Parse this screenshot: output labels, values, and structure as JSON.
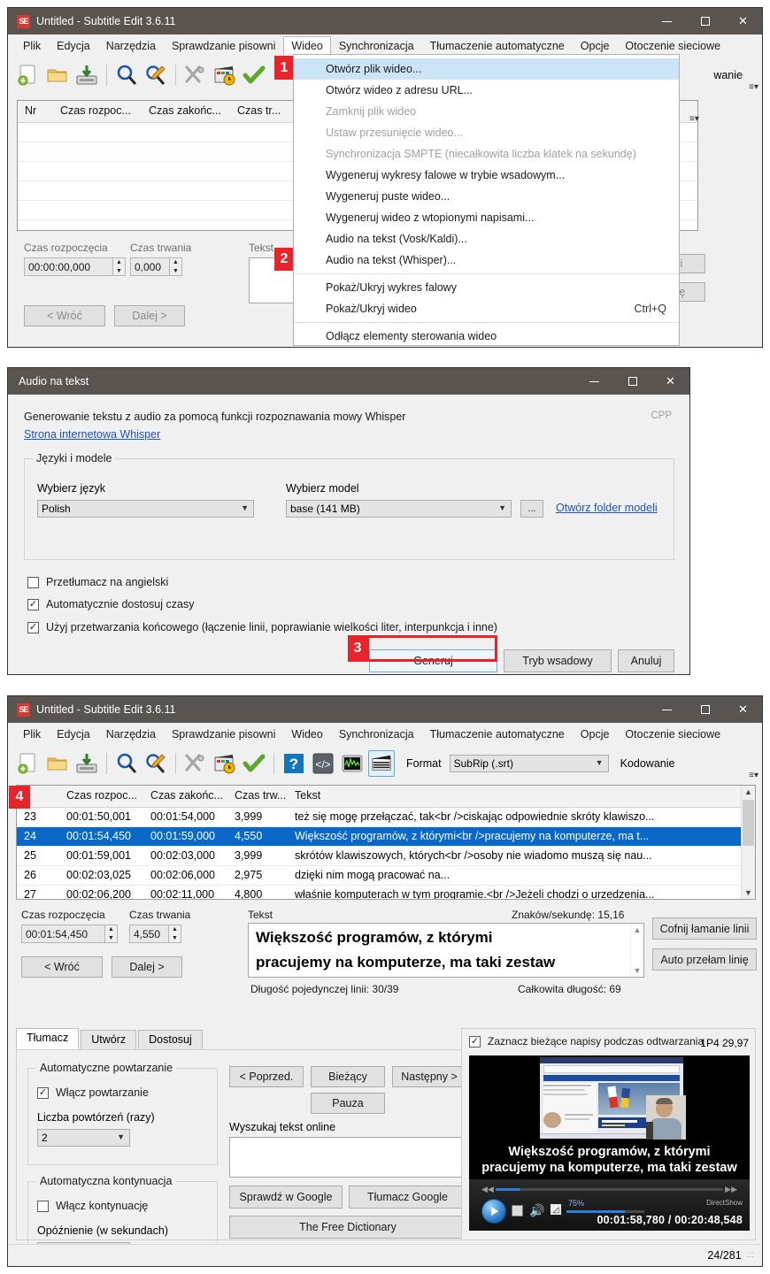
{
  "panel1": {
    "title": "Untitled - Subtitle Edit 3.6.11",
    "app_icon": "SE",
    "window_controls": {
      "minimize": "minimize-icon",
      "maximize": "maximize-icon",
      "close": "✕"
    },
    "menus": [
      "Plik",
      "Edycja",
      "Narzędzia",
      "Sprawdzanie pisowni",
      "Wideo",
      "Synchronizacja",
      "Tłumaczenie automatyczne",
      "Opcje",
      "Otoczenie sieciowe"
    ],
    "active_menu": "Wideo",
    "toolbar_right_partial": "wanie",
    "columns": [
      "Nr",
      "Czas rozpoc...",
      "Czas zakońc...",
      "Czas tr..."
    ],
    "edit": {
      "start_label": "Czas rozpoczęcia",
      "duration_label": "Czas trwania",
      "text_label": "Tekst",
      "start_value": "00:00:00,000",
      "duration_value": "0,000",
      "back_button": "< Wróć",
      "next_button": "Dalej >",
      "unbreak_button": "ij łamanie linii",
      "autobreak_button": "o przełam linię"
    },
    "dropdown": {
      "items": [
        {
          "label": "Otwórz plik wideo...",
          "state": "highlighted",
          "accel": ""
        },
        {
          "label": "Otwórz wideo z adresu URL...",
          "state": "normal",
          "accel": ""
        },
        {
          "label": "Zamknij plik wideo",
          "state": "disabled",
          "accel": ""
        },
        {
          "label": "Ustaw przesunięcie wideo...",
          "state": "disabled",
          "accel": ""
        },
        {
          "label": "Synchronizacja SMPTE (niecałkowita liczba klatek na sekundę)",
          "state": "disabled",
          "accel": ""
        },
        {
          "label": "Wygeneruj wykresy falowe w trybie wsadowym...",
          "state": "normal",
          "accel": ""
        },
        {
          "label": "Wygeneruj puste wideo...",
          "state": "normal",
          "accel": ""
        },
        {
          "label": "Wygeneruj wideo z wtopionymi napisami...",
          "state": "normal",
          "accel": ""
        },
        {
          "label": "Audio na tekst (Vosk/Kaldi)...",
          "state": "normal",
          "accel": ""
        },
        {
          "label": "Audio na tekst (Whisper)...",
          "state": "normal",
          "accel": ""
        },
        {
          "label": "Pokaż/Ukryj wykres falowy",
          "state": "normal",
          "accel": ""
        },
        {
          "label": "Pokaż/Ukryj wideo",
          "state": "normal",
          "accel": "Ctrl+Q"
        },
        {
          "label": "Odłącz elementy sterowania wideo",
          "state": "normal",
          "accel": ""
        }
      ]
    },
    "badges": [
      {
        "number": "1",
        "target": "otworz-plik-wideo"
      },
      {
        "number": "2",
        "target": "audio-na-tekst-whisper"
      }
    ]
  },
  "panel2": {
    "title": "Audio na tekst",
    "window_controls": {
      "minimize": "minimize-icon",
      "maximize": "maximize-icon",
      "close": "✕"
    },
    "description": "Generowanie tekstu z audio za pomocą funkcji rozpoznawania mowy Whisper",
    "engine_tag": "CPP",
    "website_link": "Strona internetowa Whisper",
    "group_label": "Języki i modele",
    "language_label": "Wybierz język",
    "language_value": "Polish",
    "model_label": "Wybierz model",
    "model_value": "base (141 MB)",
    "browse_button": "...",
    "open_models_folder_link": "Otwórz folder modeli",
    "checkboxes": [
      {
        "label": "Przetłumacz na angielski",
        "checked": false
      },
      {
        "label": "Automatycznie dostosuj czasy",
        "checked": true
      },
      {
        "label": "Użyj przetwarzania końcowego (łączenie linii, poprawianie wielkości liter, interpunkcja i inne)",
        "checked": true
      }
    ],
    "generate_button": "Generuj",
    "batch_button": "Tryb wsadowy",
    "cancel_button": "Anuluj",
    "badge": "3"
  },
  "panel3": {
    "title": "Untitled - Subtitle Edit 3.6.11",
    "app_icon": "SE",
    "window_controls": {
      "minimize": "minimize-icon",
      "maximize": "maximize-icon",
      "close": "✕"
    },
    "menus": [
      "Plik",
      "Edycja",
      "Narzędzia",
      "Sprawdzanie pisowni",
      "Wideo",
      "Synchronizacja",
      "Tłumaczenie automatyczne",
      "Opcje",
      "Otoczenie sieciowe"
    ],
    "format_label": "Format",
    "format_value": "SubRip (.srt)",
    "encoding_label": "Kodowanie",
    "badge": "4",
    "columns": [
      "Czas rozpoc...",
      "Czas zakońc...",
      "Czas trw...",
      "Tekst"
    ],
    "rows": [
      {
        "nr": "23",
        "start": "00:01:50,001",
        "end": "00:01:54,000",
        "duration": "3,999",
        "text": "też się mogę przełączać, tak<br />ciskając odpowiednie skróty klawiszo...",
        "selected": false
      },
      {
        "nr": "24",
        "start": "00:01:54,450",
        "end": "00:01:59,000",
        "duration": "4,550",
        "text": "Większość programów, z którymi<br />pracujemy na komputerze, ma t...",
        "selected": true
      },
      {
        "nr": "25",
        "start": "00:01:59,001",
        "end": "00:02:03,000",
        "duration": "3,999",
        "text": "skrótów klawiszowych, których<br />osoby nie wiadomo muszą się nau...",
        "selected": false
      },
      {
        "nr": "26",
        "start": "00:02:03,025",
        "end": "00:02:06,000",
        "duration": "2,975",
        "text": "dzięki nim mogą pracować na...",
        "selected": false
      },
      {
        "nr": "27",
        "start": "00:02:06,200",
        "end": "00:02:11,000",
        "duration": "4,800",
        "text": "właśnie komputerach w tym programie.<br />Jeżeli chodzi o urzedzenia...",
        "selected": false
      }
    ],
    "edit": {
      "start_label": "Czas rozpoczęcia",
      "duration_label": "Czas trwania",
      "text_label": "Tekst",
      "start_value": "00:01:54,450",
      "duration_value": "4,550",
      "cps_label": "Znaków/sekundę: 15,16",
      "text_line1": "Większość programów, z którymi",
      "text_line2": "pracujemy na komputerze, ma taki zestaw",
      "single_line_length": "Długość pojedynczej linii: 30/39",
      "total_length": "Całkowita długość: 69",
      "back_button": "< Wróć",
      "next_button": "Dalej >",
      "unbreak_button": "Cofnij łamanie linii",
      "autobreak_button": "Auto przełam linię"
    },
    "tabs": [
      {
        "label": "Tłumacz",
        "active": true
      },
      {
        "label": "Utwórz",
        "active": false
      },
      {
        "label": "Dostosuj",
        "active": false
      }
    ],
    "auto_repeat": {
      "group_label": "Automatyczne powtarzanie",
      "enable_label": "Włącz powtarzanie",
      "enable_checked": true,
      "count_label": "Liczba powtórzeń (razy)",
      "count_value": "2"
    },
    "auto_continue": {
      "group_label": "Automatyczna kontynuacja",
      "enable_label": "Włącz kontynuację",
      "enable_checked": false,
      "delay_label": "Opóźnienie (w sekundach)"
    },
    "nav_buttons": {
      "previous": "< Poprzed.",
      "current": "Bieżący",
      "next": "Następny >",
      "pause": "Pauza"
    },
    "online_search": {
      "label": "Wyszukaj tekst online",
      "value": "",
      "google_search_button": "Sprawdź w Google",
      "google_translate_button": "Tłumacz Google",
      "free_dictionary_button": "The Free Dictionary"
    },
    "video": {
      "highlight_checkbox_label": "Zaznacz bieżące napisy podczas odtwarzania",
      "highlight_checked": true,
      "format_info": "1P4 29,97",
      "subtitle_overlay": "Większość programów, z którymi pracujemy na komputerze, ma taki zestaw",
      "volume_percent": "75%",
      "engine": "DirectShow",
      "position_time": "00:01:58,780",
      "total_time": "00:20:48,548",
      "time_display": "00:01:58,780 / 00:20:48,548"
    },
    "status_bar": {
      "counter": "24/281"
    }
  },
  "colors": {
    "accent_red": "#e8232a",
    "selection_blue": "#0a68c8",
    "menu_highlight": "#cce4f7",
    "titlebar": "#5a5450",
    "link": "#1b53c4"
  }
}
